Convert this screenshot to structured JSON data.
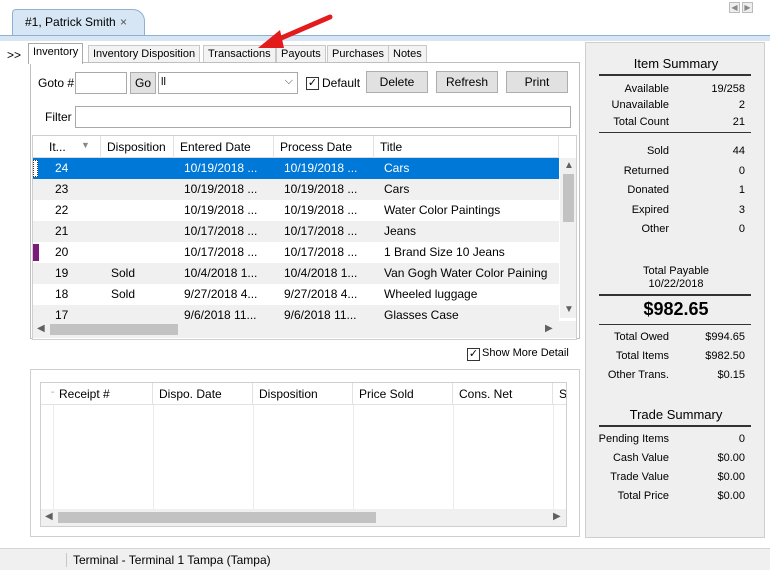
{
  "document_tab": {
    "title": "#1, Patrick Smith",
    "close": "×"
  },
  "expand_label": ">>",
  "tabs": [
    {
      "label": "Inventory"
    },
    {
      "label": "Inventory Disposition"
    },
    {
      "label": "Transactions"
    },
    {
      "label": "Payouts"
    },
    {
      "label": "Purchases"
    },
    {
      "label": "Notes"
    }
  ],
  "toolbar": {
    "goto_label": "Goto #",
    "go_button": "Go",
    "filter_combo_value": "ll",
    "default_label": "Default",
    "default_checked": true,
    "delete_button": "Delete",
    "refresh_button": "Refresh",
    "print_button": "Print",
    "filter_label": "Filter",
    "goto_value": "",
    "filter_value": ""
  },
  "inventory_grid": {
    "columns": [
      "It...",
      "Disposition",
      "Entered Date",
      "Process Date",
      "Title"
    ],
    "rows": [
      {
        "item": "24",
        "disposition": "",
        "entered": "10/19/2018 ...",
        "processed": "10/19/2018 ...",
        "title": "Cars",
        "selected": true
      },
      {
        "item": "23",
        "disposition": "",
        "entered": "10/19/2018 ...",
        "processed": "10/19/2018 ...",
        "title": "Cars"
      },
      {
        "item": "22",
        "disposition": "",
        "entered": "10/19/2018 ...",
        "processed": "10/19/2018 ...",
        "title": "Water Color Paintings"
      },
      {
        "item": "21",
        "disposition": "",
        "entered": "10/17/2018 ...",
        "processed": "10/17/2018 ...",
        "title": "Jeans"
      },
      {
        "item": "20",
        "disposition": "",
        "entered": "10/17/2018 ...",
        "processed": "10/17/2018 ...",
        "title": "1 Brand Size 10 Jeans",
        "marker": "#7b1c7b"
      },
      {
        "item": "19",
        "disposition": "Sold",
        "entered": "10/4/2018 1...",
        "processed": "10/4/2018 1...",
        "title": "Van Gogh Water Color Paining"
      },
      {
        "item": "18",
        "disposition": "Sold",
        "entered": "9/27/2018 4...",
        "processed": "9/27/2018 4...",
        "title": "Wheeled luggage"
      },
      {
        "item": "17",
        "disposition": "",
        "entered": "9/6/2018 11...",
        "processed": "9/6/2018 11...",
        "title": "Glasses Case"
      }
    ]
  },
  "show_more_detail": {
    "label": "Show More Detail",
    "checked": true
  },
  "receipt_grid": {
    "columns": [
      "Receipt #",
      "Dispo. Date",
      "Disposition",
      "Price Sold",
      "Cons. Net",
      "S"
    ]
  },
  "item_summary": {
    "title": "Item Summary",
    "group1": [
      {
        "label": "Available",
        "value": "19/258"
      },
      {
        "label": "Unavailable",
        "value": "2"
      },
      {
        "label": "Total Count",
        "value": "21"
      }
    ],
    "group2": [
      {
        "label": "Sold",
        "value": "44"
      },
      {
        "label": "Returned",
        "value": "0"
      },
      {
        "label": "Donated",
        "value": "1"
      },
      {
        "label": "Expired",
        "value": "3"
      },
      {
        "label": "Other",
        "value": "0"
      }
    ],
    "total_payable_label": "Total Payable",
    "total_payable_date": "10/22/2018",
    "total_payable_amount": "$982.65",
    "group3": [
      {
        "label": "Total Owed",
        "value": "$994.65"
      },
      {
        "label": "Total Items",
        "value": "$982.50"
      },
      {
        "label": "Other Trans.",
        "value": "$0.15"
      }
    ]
  },
  "trade_summary": {
    "title": "Trade Summary",
    "rows": [
      {
        "label": "Pending Items",
        "value": "0"
      },
      {
        "label": "Cash Value",
        "value": "$0.00"
      },
      {
        "label": "Trade Value",
        "value": "$0.00"
      },
      {
        "label": "Total Price",
        "value": "$0.00"
      }
    ]
  },
  "status_bar": {
    "text": "Terminal - Terminal 1 Tampa (Tampa)"
  },
  "colors": {
    "selection": "#0078d7",
    "tab_header": "#d6e6f5",
    "arrow": "#e31b1b",
    "row_marker": "#7b1c7b"
  }
}
